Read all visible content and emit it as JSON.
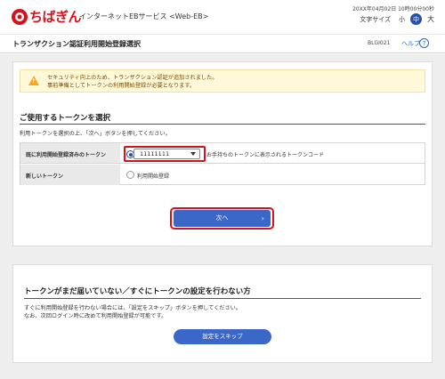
{
  "header": {
    "brand_name": "ちばぎん",
    "brand_sub": "インターネットEBサービス <Web-EB>",
    "datetime": "20XX年04月02日 10時00分00秒",
    "font_size_label": "文字サイズ",
    "font_size_small": "小",
    "font_size_medium": "中",
    "font_size_large": "大"
  },
  "titlebar": {
    "title": "トランザクション認証利用開始登録選択",
    "screen_id": "BLGI021",
    "help_label": "ヘルプ",
    "help_icon": "?"
  },
  "notice": {
    "line1": "セキュリティ向上のため、トランザクション認証が追加されました。",
    "line2": "事前準備としてトークンの利用開始登録が必要となります。"
  },
  "token_section": {
    "title": "ご使用するトークンを選択",
    "instruction": "利用トークンを選択の上、「次へ」ボタンを押してください。",
    "row1_label": "既に利用開始登録済みのトークン",
    "row1_value": "11111111",
    "row1_hint": "お手持ちのトークンに表示されるトークンコード",
    "row2_label": "新しいトークン",
    "row2_value": "利用開始登録",
    "next_label": "次へ",
    "next_chevron": "›"
  },
  "skip_section": {
    "title": "トークンがまだ届いていない／すぐにトークンの設定を行わない方",
    "line1": "すぐに利用開始登録を行わない場合には、「設定をスキップ」ボタンを押してください。",
    "line2": "なお、次回ログイン時に改めて利用開始登録が可能です。",
    "skip_label": "設定をスキップ"
  },
  "colors": {
    "brand_red": "#d3121b",
    "button_blue": "#3b67c9",
    "notice_bg": "#fff8d9",
    "warn_orange": "#f5a623"
  },
  "icons": [
    "chibagin-logo-icon",
    "warning-icon",
    "help-icon",
    "chevron-right-icon",
    "caret-down-icon"
  ]
}
